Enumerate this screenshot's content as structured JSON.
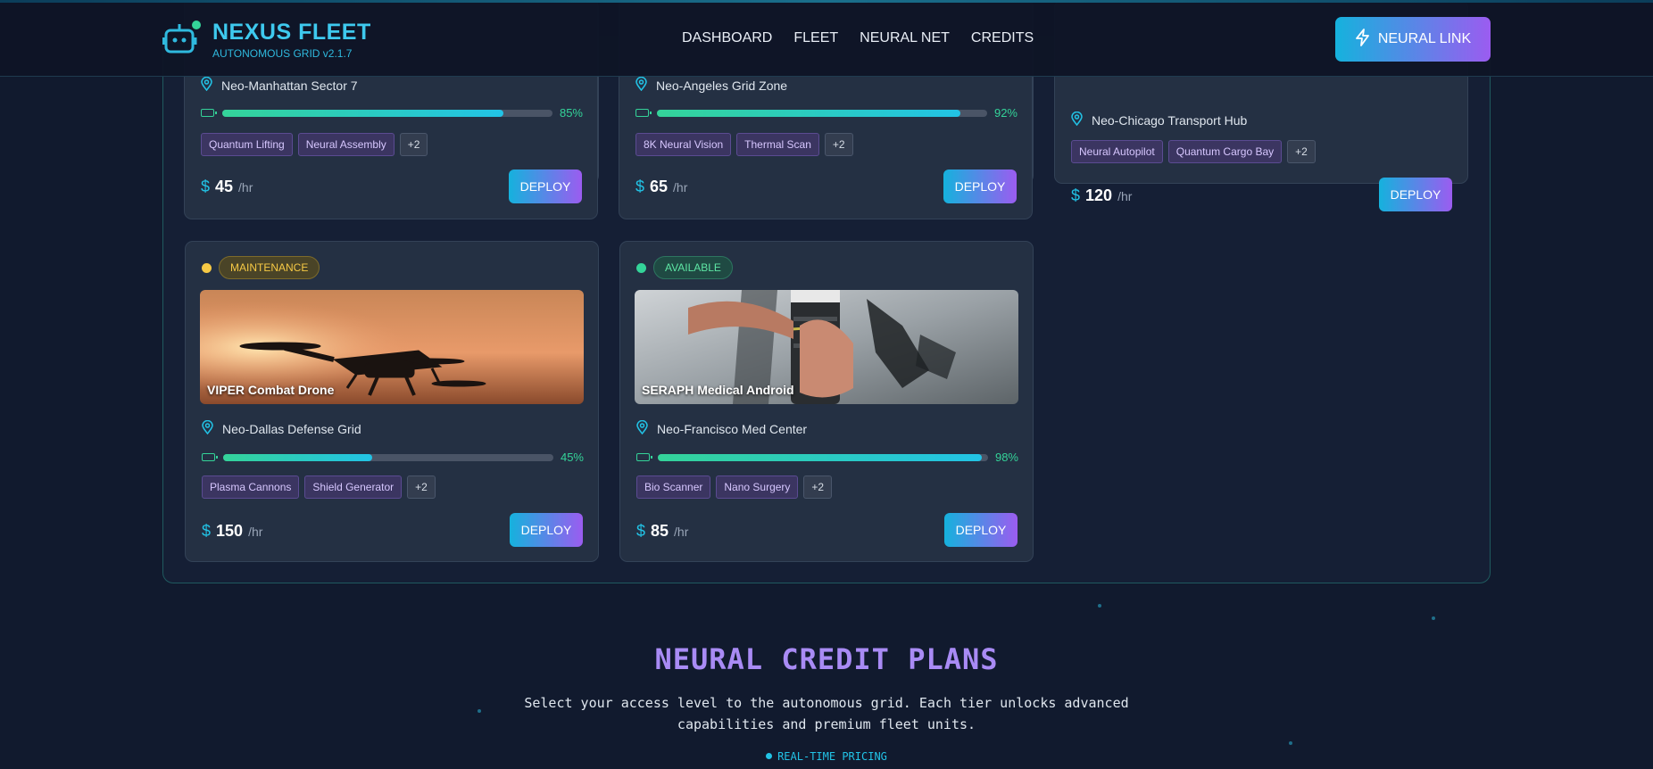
{
  "header": {
    "brand_title": "NEXUS FLEET",
    "brand_subtitle": "AUTONOMOUS GRID v2.1.7",
    "nav": [
      "DASHBOARD",
      "FLEET",
      "NEURAL NET",
      "CREDITS"
    ],
    "cta_label": "NEURAL LINK"
  },
  "cards": [
    {
      "location": "Neo-Manhattan Sector 7",
      "battery": 85,
      "battery_label": "85%",
      "tags": [
        "Quantum Lifting",
        "Neural Assembly",
        "+2"
      ],
      "currency": "$",
      "price": "45",
      "unit": "/hr",
      "deploy": "DEPLOY"
    },
    {
      "location": "Neo-Angeles Grid Zone",
      "battery": 92,
      "battery_label": "92%",
      "tags": [
        "8K Neural Vision",
        "Thermal Scan",
        "+2"
      ],
      "currency": "$",
      "price": "65",
      "unit": "/hr",
      "deploy": "DEPLOY"
    },
    {
      "location": "Neo-Chicago Transport Hub",
      "tags": [
        "Neural Autopilot",
        "Quantum Cargo Bay",
        "+2"
      ],
      "currency": "$",
      "price": "120",
      "unit": "/hr",
      "deploy": "DEPLOY"
    },
    {
      "status": "MAINTENANCE",
      "status_color": "#f6c945",
      "image_label": "VIPER Combat Drone",
      "location": "Neo-Dallas Defense Grid",
      "battery": 45,
      "battery_label": "45%",
      "tags": [
        "Plasma Cannons",
        "Shield Generator",
        "+2"
      ],
      "currency": "$",
      "price": "150",
      "unit": "/hr",
      "deploy": "DEPLOY"
    },
    {
      "status": "AVAILABLE",
      "status_color": "#34d399",
      "image_label": "SERAPH Medical Android",
      "location": "Neo-Francisco Med Center",
      "battery": 98,
      "battery_label": "98%",
      "tags": [
        "Bio Scanner",
        "Nano Surgery",
        "+2"
      ],
      "currency": "$",
      "price": "85",
      "unit": "/hr",
      "deploy": "DEPLOY"
    }
  ],
  "plans": {
    "title": "NEURAL CREDIT PLANS",
    "description_line1": "Select your access level to the autonomous grid. Each tier unlocks advanced",
    "description_line2": "capabilities and premium fleet units.",
    "realtime": "REAL-TIME PRICING"
  },
  "colors": {
    "accent": "#22c3e6",
    "purple": "#9b5cf0",
    "battery": "#34d399"
  },
  "icons": [
    "robot-logo-icon",
    "lightning-icon",
    "location-pin-icon",
    "battery-icon"
  ]
}
